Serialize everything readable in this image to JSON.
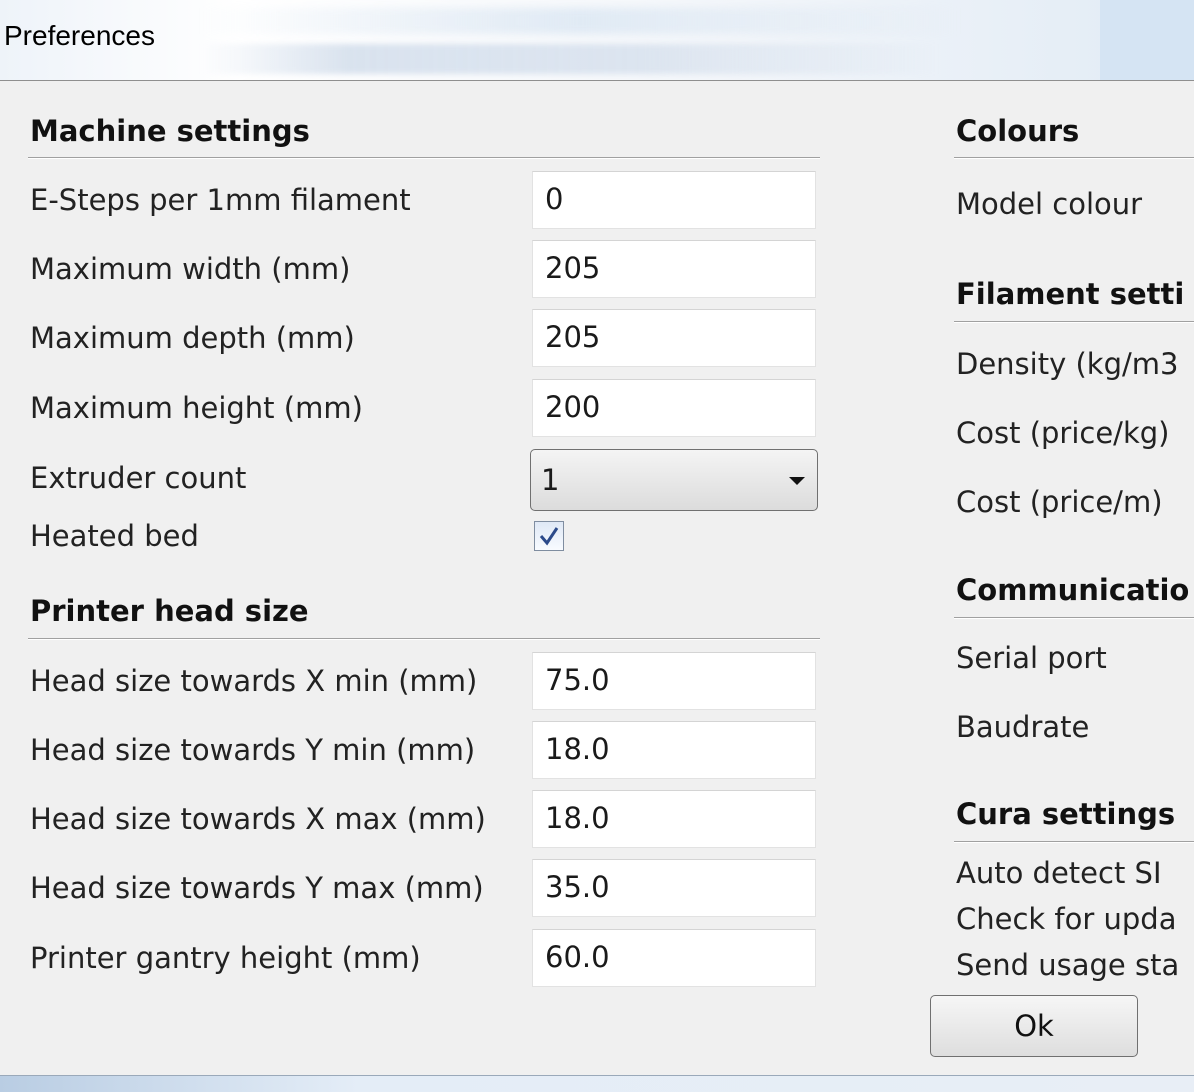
{
  "window": {
    "title": "Preferences"
  },
  "machine": {
    "title": "Machine settings",
    "esteps": {
      "label": "E-Steps per 1mm filament",
      "value": "0"
    },
    "max_width": {
      "label": "Maximum width (mm)",
      "value": "205"
    },
    "max_depth": {
      "label": "Maximum depth (mm)",
      "value": "205"
    },
    "max_height": {
      "label": "Maximum height (mm)",
      "value": "200"
    },
    "extruder": {
      "label": "Extruder count",
      "value": "1"
    },
    "heated_bed": {
      "label": "Heated bed",
      "checked": true
    }
  },
  "head": {
    "title": "Printer head size",
    "xmin": {
      "label": "Head size towards X min (mm)",
      "value": "75.0"
    },
    "ymin": {
      "label": "Head size towards Y min (mm)",
      "value": "18.0"
    },
    "xmax": {
      "label": "Head size towards X max (mm)",
      "value": "18.0"
    },
    "ymax": {
      "label": "Head size towards Y max (mm)",
      "value": "35.0"
    },
    "gantry": {
      "label": "Printer gantry height (mm)",
      "value": "60.0"
    }
  },
  "colours": {
    "title": "Colours",
    "model_colour": "Model colour"
  },
  "filament": {
    "title": "Filament setti",
    "density": "Density (kg/m3",
    "cost_kg": "Cost (price/kg)",
    "cost_m": "Cost (price/m)"
  },
  "communication": {
    "title": "Communicatio",
    "serial_port": "Serial port",
    "baudrate": "Baudrate"
  },
  "cura": {
    "title": "Cura settings",
    "auto_detect": "Auto detect SI",
    "check_updates": "Check for upda",
    "send_usage": "Send usage sta"
  },
  "buttons": {
    "ok": "Ok"
  }
}
